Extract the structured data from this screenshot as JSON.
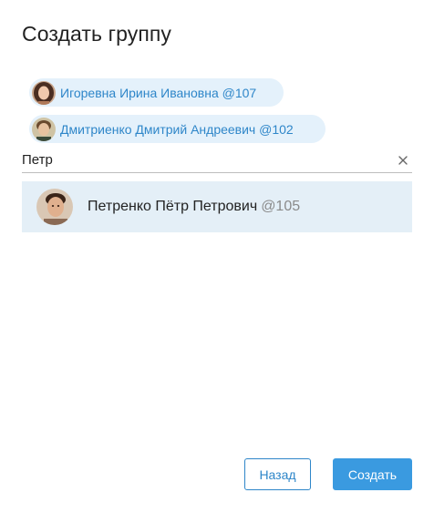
{
  "dialog": {
    "title": "Создать группу"
  },
  "selected_members": [
    {
      "name": "Игоревна Ирина Ивановна @107",
      "avatar": "female-avatar-icon"
    },
    {
      "name": "Дмитриенко Дмитрий Андреевич @102",
      "avatar": "male-avatar-icon"
    }
  ],
  "search": {
    "value": "Петр",
    "clear_icon": "close-icon"
  },
  "results": [
    {
      "name": "Петренко Пётр Петрович",
      "handle": "@105",
      "avatar": "male-avatar-icon"
    }
  ],
  "buttons": {
    "back_label": "Назад",
    "create_label": "Создать"
  },
  "colors": {
    "accent": "#3a9ae0",
    "chip_bg": "#e4f1fb",
    "chip_text": "#2e86c9",
    "result_bg": "#e4eff7"
  }
}
